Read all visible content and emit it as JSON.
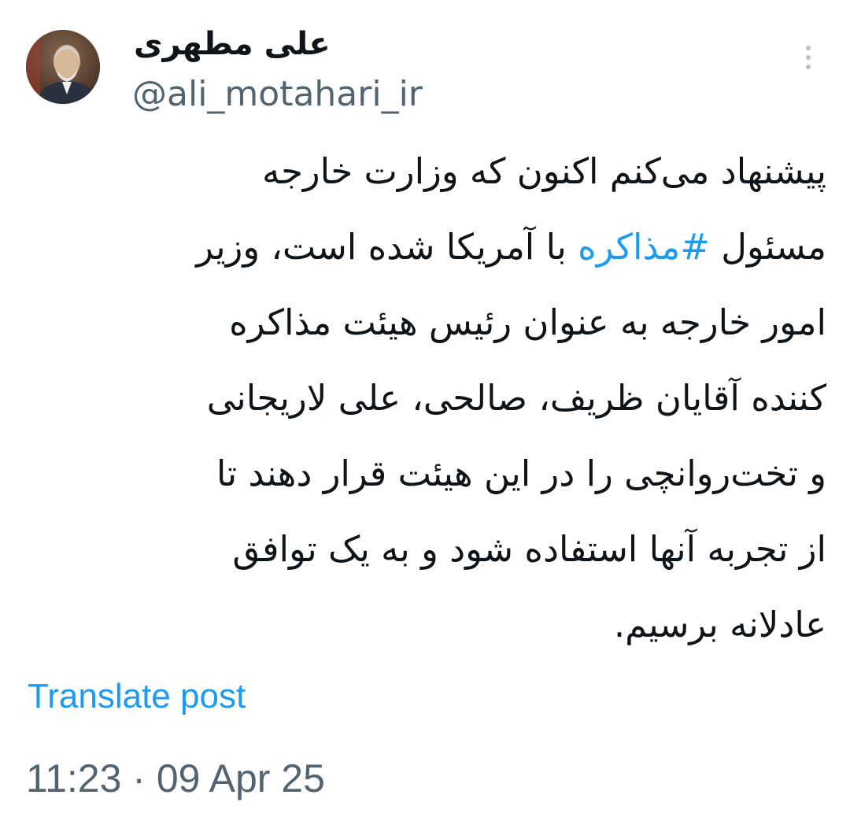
{
  "author": {
    "display_name": "علی مطهری",
    "handle": "@ali_motahari_ir",
    "avatar_icon": "profile-photo"
  },
  "menu": {
    "icon": "more-vertical-icon"
  },
  "tweet": {
    "lines": [
      {
        "before": "پیشنهاد می‌کنم اکنون که وزارت خارجه",
        "hashtag": "",
        "after": ""
      },
      {
        "before": "مسئول ",
        "hashtag": "#مذاکره",
        "after": " با آمریکا شده است، وزیر"
      },
      {
        "before": "امور خارجه به عنوان رئیس هیئت مذاکره",
        "hashtag": "",
        "after": ""
      },
      {
        "before": "کننده آقایان ظریف، صالحی، علی لاریجانی",
        "hashtag": "",
        "after": ""
      },
      {
        "before": "و تخت‌روانچی را در این هیئت قرار دهند تا",
        "hashtag": "",
        "after": ""
      },
      {
        "before": "از تجربه آنها استفاده شود و به یک توافق",
        "hashtag": "",
        "after": ""
      },
      {
        "before": "عادلانه برسیم.",
        "hashtag": "",
        "after": ""
      }
    ],
    "translate_label": "Translate post",
    "timestamp": "11:23 · 09 Apr 25"
  },
  "colors": {
    "link": "#1d9bf0",
    "secondary_text": "#536471",
    "primary_text": "#0f1419",
    "background": "#ffffff"
  }
}
